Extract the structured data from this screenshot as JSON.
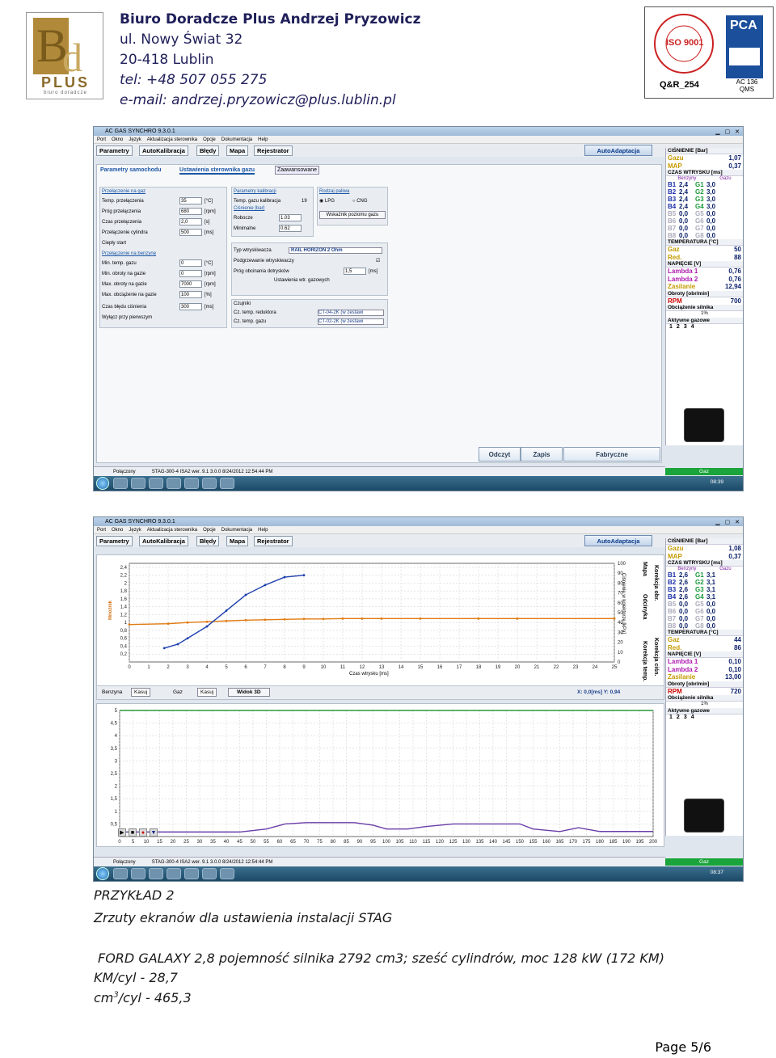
{
  "header": {
    "company": "Biuro Doradcze Plus Andrzej Pryzowicz",
    "street": "ul. Nowy Świat 32",
    "city": "20-418 Lublin",
    "phone": "tel: +48 507 055 275",
    "email": "e-mail: andrzej.pryzowicz@plus.lublin.pl",
    "logo_text": "PLUS",
    "logo_sub": "biuro doradcze",
    "cert_left": "Q&R_254",
    "cert_right": "AC 136 QMS",
    "cert_iso": "ISO 9001",
    "cert_pca": "PCA"
  },
  "app": {
    "title": "AC GAS SYNCHRO 9.3.0.1",
    "menu": [
      "Port",
      "Okno",
      "Język",
      "Aktualizacja sterownika",
      "Opcje",
      "Dokumentacja",
      "Help"
    ],
    "tabs": [
      "Parametry",
      "AutoKalibracja",
      "Błędy",
      "Mapa",
      "Rejestrator"
    ],
    "autoadapt": "AutoAdaptacja",
    "status_left": "Połączony",
    "status_mid": "STAG-300-4 ISA2   wer. 9.1  3.0.0   8/24/2012 12:54:44 PM",
    "gaz": "Gaz",
    "clock": "08:39",
    "clock2": "08:37"
  },
  "screen1": {
    "subtabs": [
      "Parametry samochodu",
      "Ustawienia sterownika gazu",
      "Zaawansowane"
    ],
    "switch_panel": {
      "title": "Przełączenie na gaz",
      "rows": [
        {
          "label": "Temp. przełączenia",
          "value": "35",
          "unit": "[°C]"
        },
        {
          "label": "Próg przełączenia",
          "value": "680",
          "unit": "[rpm]"
        },
        {
          "label": "Czas przełączenia",
          "value": "2,0",
          "unit": "[s]"
        },
        {
          "label": "Przełączenie cylindra",
          "value": "500",
          "unit": "[ms]"
        },
        {
          "label": "Ciepły start",
          "value": "",
          "unit": ""
        }
      ]
    },
    "petrol_panel": {
      "title": "Przełączenie na benzynę",
      "rows": [
        {
          "label": "Min. temp. gazu",
          "value": "0",
          "unit": "[°C]"
        },
        {
          "label": "Min. obroty na gazie",
          "value": "0",
          "unit": "[rpm]"
        },
        {
          "label": "Max. obroty na gazie",
          "value": "7000",
          "unit": "[rpm]"
        },
        {
          "label": "Max. obciążenie na gazie",
          "value": "100",
          "unit": "[%]"
        },
        {
          "label": "Czas błędu ciśnienia",
          "value": "300",
          "unit": "[ms]"
        },
        {
          "label": "Wyłącz przy pierwszym",
          "value": "",
          "unit": ""
        }
      ]
    },
    "calib_panel": {
      "title": "Parametry kalibracji",
      "temp_label": "Temp. gazu kalibracja",
      "temp_value": "19",
      "pressure_title": "Ciśnienie [bar]",
      "robocze_label": "Robocze",
      "robocze_value": "1.03",
      "min_label": "Minimalne",
      "min_value": "0.62"
    },
    "fuel_panel": {
      "title": "Rodzaj paliwa",
      "lpg": "LPG",
      "cng": "CNG",
      "level_btn": "Wskaźnik poziomu gazu"
    },
    "injector": {
      "type_label": "Typ wtryskiwacza",
      "type_value": "RAIL HORIZON 2 Ohm",
      "heat_label": "Podgrzewanie wtryskiwaczy",
      "cutoff_label": "Próg obcinania dotrysków",
      "cutoff_value": "1,5",
      "cutoff_unit": "[ms]",
      "settings_btn": "Ustawienia wtr. gazowych"
    },
    "sensors": {
      "title": "Czujniki",
      "reducer_label": "Cz. temp. reduktora",
      "reducer_value": "CT-04-2K (w zestawi",
      "gas_label": "Cz. temp. gazu",
      "gas_value": "CT-02-2K (w zestawi"
    },
    "bottom_btns": [
      "Odczyt",
      "Zapis",
      "Fabryczne"
    ]
  },
  "side1": {
    "pressure_title": "CIŚNIENIE [Bar]",
    "gaz_label": "Gazu",
    "gaz_value": "1,07",
    "map_label": "MAP",
    "map_value": "0,37",
    "inj_title": "CZAS WTRYSKU [ms]",
    "col_b": "Benzyny",
    "col_g": "Gazu",
    "inj": [
      [
        "B1",
        "2,4",
        "G1",
        "3,0"
      ],
      [
        "B2",
        "2,4",
        "G2",
        "3,0"
      ],
      [
        "B3",
        "2,4",
        "G3",
        "3,0"
      ],
      [
        "B4",
        "2,4",
        "G4",
        "3,0"
      ],
      [
        "B5",
        "0,0",
        "G5",
        "0,0"
      ],
      [
        "B6",
        "0,0",
        "G6",
        "0,0"
      ],
      [
        "B7",
        "0,0",
        "G7",
        "0,0"
      ],
      [
        "B8",
        "0,0",
        "G8",
        "0,0"
      ]
    ],
    "temp_title": "TEMPERATURA [°C]",
    "temp_gaz": "50",
    "temp_red": "88",
    "volt_title": "NAPIĘCIE [V]",
    "lambda1": "0,76",
    "lambda2": "0,76",
    "zasilanie": "12,94",
    "rpm_title": "Obroty [obr/min]",
    "rpm": "700",
    "load_title": "Obciążenie silnika",
    "load": "1%",
    "active_title": "Aktywne gazowe",
    "active": [
      "1",
      "2",
      "3",
      "4"
    ]
  },
  "side2": {
    "gaz_value": "1,08",
    "map_value": "0,37",
    "inj": [
      [
        "B1",
        "2,6",
        "G1",
        "3,1"
      ],
      [
        "B2",
        "2,6",
        "G2",
        "3,1"
      ],
      [
        "B3",
        "2,6",
        "G3",
        "3,1"
      ],
      [
        "B4",
        "2,6",
        "G4",
        "3,1"
      ],
      [
        "B5",
        "0,0",
        "G5",
        "0,0"
      ],
      [
        "B6",
        "0,0",
        "G6",
        "0,0"
      ],
      [
        "B7",
        "0,0",
        "G7",
        "0,0"
      ],
      [
        "B8",
        "0,0",
        "G8",
        "0,0"
      ]
    ],
    "temp_gaz": "44",
    "temp_red": "86",
    "lambda1": "0,10",
    "lambda2": "0,10",
    "zasilanie": "13,00",
    "rpm": "720",
    "load": "1%"
  },
  "screen2": {
    "map_side_tabs": [
      "Mapa",
      "Korekcja obr.",
      "Odcinyka",
      "Korekcja ciśn.",
      "Korekcja temp."
    ],
    "y_label": "Ciśnienie w kolektorze [kPa]",
    "mnoznik": "Mnożnik",
    "x_label": "Czas wtrysku [ms]",
    "benzyna": "Benzyna",
    "kasuj1": "Kasuj",
    "gaz2": "Gaz",
    "kasuj2": "Kasuj",
    "widok3d": "Widok 3D",
    "xy_readout": "X:  0,0[ms] Y: 0,94"
  },
  "chart_data": [
    {
      "type": "line",
      "title": "",
      "xlabel": "Czas wtrysku [ms]",
      "ylabel": "Mnożnik",
      "x_ticks": [
        0,
        1,
        2,
        3,
        4,
        5,
        6,
        7,
        8,
        9,
        10,
        11,
        12,
        13,
        14,
        15,
        16,
        17,
        18,
        19,
        20,
        21,
        22,
        23,
        24,
        25
      ],
      "y_ticks": [
        0.2,
        0.4,
        0.6,
        0.8,
        1,
        1.2,
        1.4,
        1.6,
        1.8,
        2,
        2.2,
        2.4
      ],
      "y2_ticks": [
        0,
        10,
        20,
        30,
        40,
        50,
        60,
        70,
        80,
        90,
        100
      ],
      "xlim": [
        0,
        25
      ],
      "ylim": [
        0,
        2.5
      ],
      "series": [
        {
          "color": "#e07a10",
          "x": [
            0,
            2,
            3,
            4,
            5,
            6,
            7,
            8,
            9,
            10,
            11,
            12,
            13,
            15,
            18,
            20,
            25
          ],
          "y": [
            0.95,
            0.97,
            1.0,
            1.02,
            1.04,
            1.06,
            1.07,
            1.08,
            1.09,
            1.09,
            1.1,
            1.1,
            1.1,
            1.1,
            1.1,
            1.1,
            1.1
          ]
        },
        {
          "color": "#1d3fae",
          "x": [
            1.8,
            2.5,
            3,
            4,
            5,
            6,
            7,
            8,
            9
          ],
          "y": [
            0.35,
            0.45,
            0.6,
            0.9,
            1.3,
            1.7,
            1.95,
            2.15,
            2.2
          ]
        }
      ]
    },
    {
      "type": "line",
      "title": "",
      "x_ticks": [
        0,
        5,
        10,
        15,
        20,
        25,
        30,
        35,
        40,
        45,
        50,
        55,
        60,
        65,
        70,
        75,
        80,
        85,
        90,
        95,
        100,
        105,
        110,
        115,
        120,
        125,
        130,
        135,
        140,
        145,
        150,
        155,
        160,
        165,
        170,
        175,
        180,
        185,
        190,
        195,
        200
      ],
      "y_ticks": [
        0.5,
        1,
        1.5,
        2,
        2.5,
        3,
        3.5,
        4,
        4.5,
        5
      ],
      "xlim": [
        0,
        200
      ],
      "ylim": [
        0,
        5
      ],
      "series": [
        {
          "color": "#6a3ea8",
          "x": [
            0,
            45,
            55,
            62,
            70,
            88,
            95,
            100,
            108,
            115,
            125,
            150,
            155,
            165,
            172,
            180,
            200
          ],
          "y": [
            0.18,
            0.18,
            0.3,
            0.5,
            0.55,
            0.55,
            0.45,
            0.3,
            0.3,
            0.4,
            0.5,
            0.5,
            0.3,
            0.2,
            0.35,
            0.2,
            0.2
          ]
        },
        {
          "color": "#2a9a3a",
          "x": [
            0,
            200
          ],
          "y": [
            5,
            5
          ]
        }
      ]
    }
  ],
  "captions": {
    "line1": "PRZYKŁAD 2",
    "line2": "Zrzuty ekranów dla ustawienia instalacji STAG",
    "line3": "FORD GALAXY 2,8 pojemność silnika 2792 cm3; sześć cylindrów, moc 128 kW (172 KM)",
    "line4": "KM/cyl - 28,7",
    "line5_pre": "cm",
    "line5_sup": "3",
    "line5_post": "/cyl - 465,3",
    "page": "Page 5/6"
  }
}
